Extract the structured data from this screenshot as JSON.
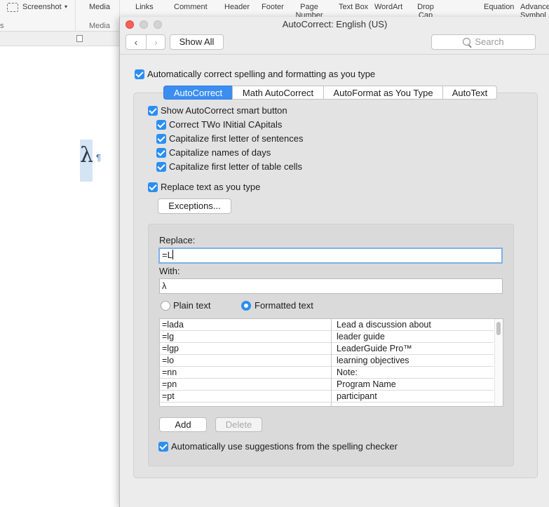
{
  "ribbon": {
    "screenshot": "Screenshot",
    "media": "Media",
    "links": "Links",
    "comment": "Comment",
    "header": "Header",
    "footer": "Footer",
    "page_number": "Page Number",
    "text_box": "Text Box",
    "wordart": "WordArt",
    "drop_cap": "Drop Cap",
    "equation": "Equation",
    "advanced_symbol": "Advanced Symbol",
    "group_media": "Media",
    "group_left": "s"
  },
  "document": {
    "lambda": "λ",
    "pilcrow": "¶"
  },
  "dialog": {
    "title": "AutoCorrect: English (US)",
    "show_all": "Show All",
    "search_placeholder": "Search",
    "auto_correct_label": "Automatically correct spelling and formatting as you type",
    "tabs": [
      "AutoCorrect",
      "Math AutoCorrect",
      "AutoFormat as You Type",
      "AutoText"
    ],
    "options": {
      "show_smart_button": "Show AutoCorrect smart button",
      "correct_two_initial": "Correct TWo INitial CApitals",
      "capitalize_sentences": "Capitalize first letter of sentences",
      "capitalize_days": "Capitalize names of days",
      "capitalize_table_cells": "Capitalize first letter of table cells",
      "replace_text": "Replace text as you type"
    },
    "exceptions_button": "Exceptions...",
    "replace_label": "Replace:",
    "replace_value": "=L",
    "with_label": "With:",
    "with_value": "λ",
    "plain_text": "Plain text",
    "formatted_text": "Formatted text",
    "entries": [
      {
        "key": "=lada",
        "value": "Lead a discussion about"
      },
      {
        "key": "=lg",
        "value": "leader guide"
      },
      {
        "key": "=lgp",
        "value": "LeaderGuide Pro™"
      },
      {
        "key": "=lo",
        "value": "learning objectives"
      },
      {
        "key": "=nn",
        "value": "Note:"
      },
      {
        "key": "=pn",
        "value": "Program Name"
      },
      {
        "key": "=pt",
        "value": "participant"
      }
    ],
    "add_button": "Add",
    "delete_button": "Delete",
    "spelling_suggestions": "Automatically use suggestions from the spelling checker"
  },
  "colors": {
    "accent": "#2b8ef4",
    "selected_tab": "#3b8ef0",
    "close_light": "#fc5f57"
  }
}
